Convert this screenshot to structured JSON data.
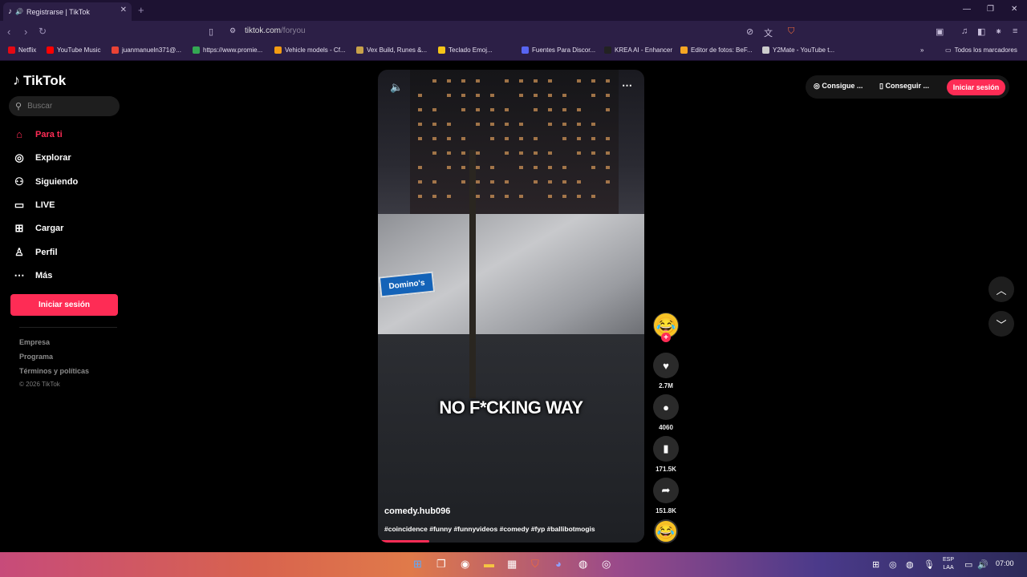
{
  "browser": {
    "tab_title": "Registrarse | TikTok",
    "url_host": "tiktok.com",
    "url_path": "/foryou",
    "bookmarks": [
      {
        "label": "Netflix",
        "color": "#e50914"
      },
      {
        "label": "YouTube Music",
        "color": "#ff0000"
      },
      {
        "label": "juanmanueln371@...",
        "color": "#ea4335"
      },
      {
        "label": "https://www.promie...",
        "color": "#34a853"
      },
      {
        "label": "Vehicle models - Cf...",
        "color": "#f39c12"
      },
      {
        "label": "Vex Build, Runes &...",
        "color": "#c8a24a"
      },
      {
        "label": "Teclado Emoj...",
        "color": "#f5c518"
      },
      {
        "label": "Fuentes Para Discor...",
        "color": "#5865f2"
      },
      {
        "label": "KREA AI - Enhancer",
        "color": "#222222"
      },
      {
        "label": "Editor de fotos: BeF...",
        "color": "#f5a623"
      },
      {
        "label": "Y2Mate - YouTube t...",
        "color": "#cccccc"
      }
    ],
    "all_bookmarks": "Todos los marcadores"
  },
  "sidebar": {
    "logo": "TikTok",
    "search_placeholder": "Buscar",
    "items": [
      {
        "label": "Para ti",
        "icon": "home-icon",
        "glyph": "⌂",
        "active": true
      },
      {
        "label": "Explorar",
        "icon": "compass-icon",
        "glyph": "◎"
      },
      {
        "label": "Siguiendo",
        "icon": "following-icon",
        "glyph": "⚇"
      },
      {
        "label": "LIVE",
        "icon": "live-icon",
        "glyph": "▭"
      },
      {
        "label": "Cargar",
        "icon": "upload-icon",
        "glyph": "⊞"
      },
      {
        "label": "Perfil",
        "icon": "profile-icon",
        "glyph": "♙"
      },
      {
        "label": "Más",
        "icon": "more-icon",
        "glyph": "⋯"
      }
    ],
    "login_button": "Iniciar sesión",
    "footer_links": [
      "Empresa",
      "Programa",
      "Términos y políticas"
    ],
    "copyright": "© 2026 TikTok"
  },
  "topbar": {
    "coins": "Consigue ...",
    "get_app": "Conseguir ...",
    "login_button": "Iniciar sesión"
  },
  "video": {
    "caption": "NO F*CKING WAY",
    "author": "comedy.hub096",
    "tags": "#coincidence #funny #funnyvideos #comedy #fyp #ballibotmogis",
    "sign_text": "Domino's",
    "progress": 0.18
  },
  "actions": {
    "likes": "2.7M",
    "comments": "4060",
    "saves": "171.5K",
    "shares": "151.8K"
  },
  "taskbar": {
    "lang_top": "ESP",
    "lang_bottom": "LAA",
    "time": "07:00"
  }
}
